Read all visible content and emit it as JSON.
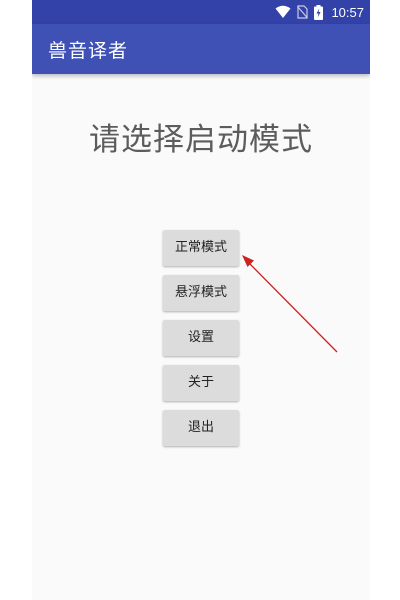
{
  "status_bar": {
    "time": "10:57",
    "icons": [
      "wifi-icon",
      "no-sim-icon",
      "battery-charging-icon"
    ]
  },
  "app_bar": {
    "title": "兽音译者"
  },
  "main": {
    "heading": "请选择启动模式",
    "buttons": [
      {
        "label": "正常模式"
      },
      {
        "label": "悬浮模式"
      },
      {
        "label": "设置"
      },
      {
        "label": "关于"
      },
      {
        "label": "退出"
      }
    ]
  },
  "annotation": {
    "arrow_color": "#cc2222",
    "points_to": "正常模式"
  },
  "colors": {
    "primary": "#3f51b5",
    "primary_dark": "#3242a8",
    "button_bg": "#dcdcdc",
    "background": "#fafafa"
  }
}
